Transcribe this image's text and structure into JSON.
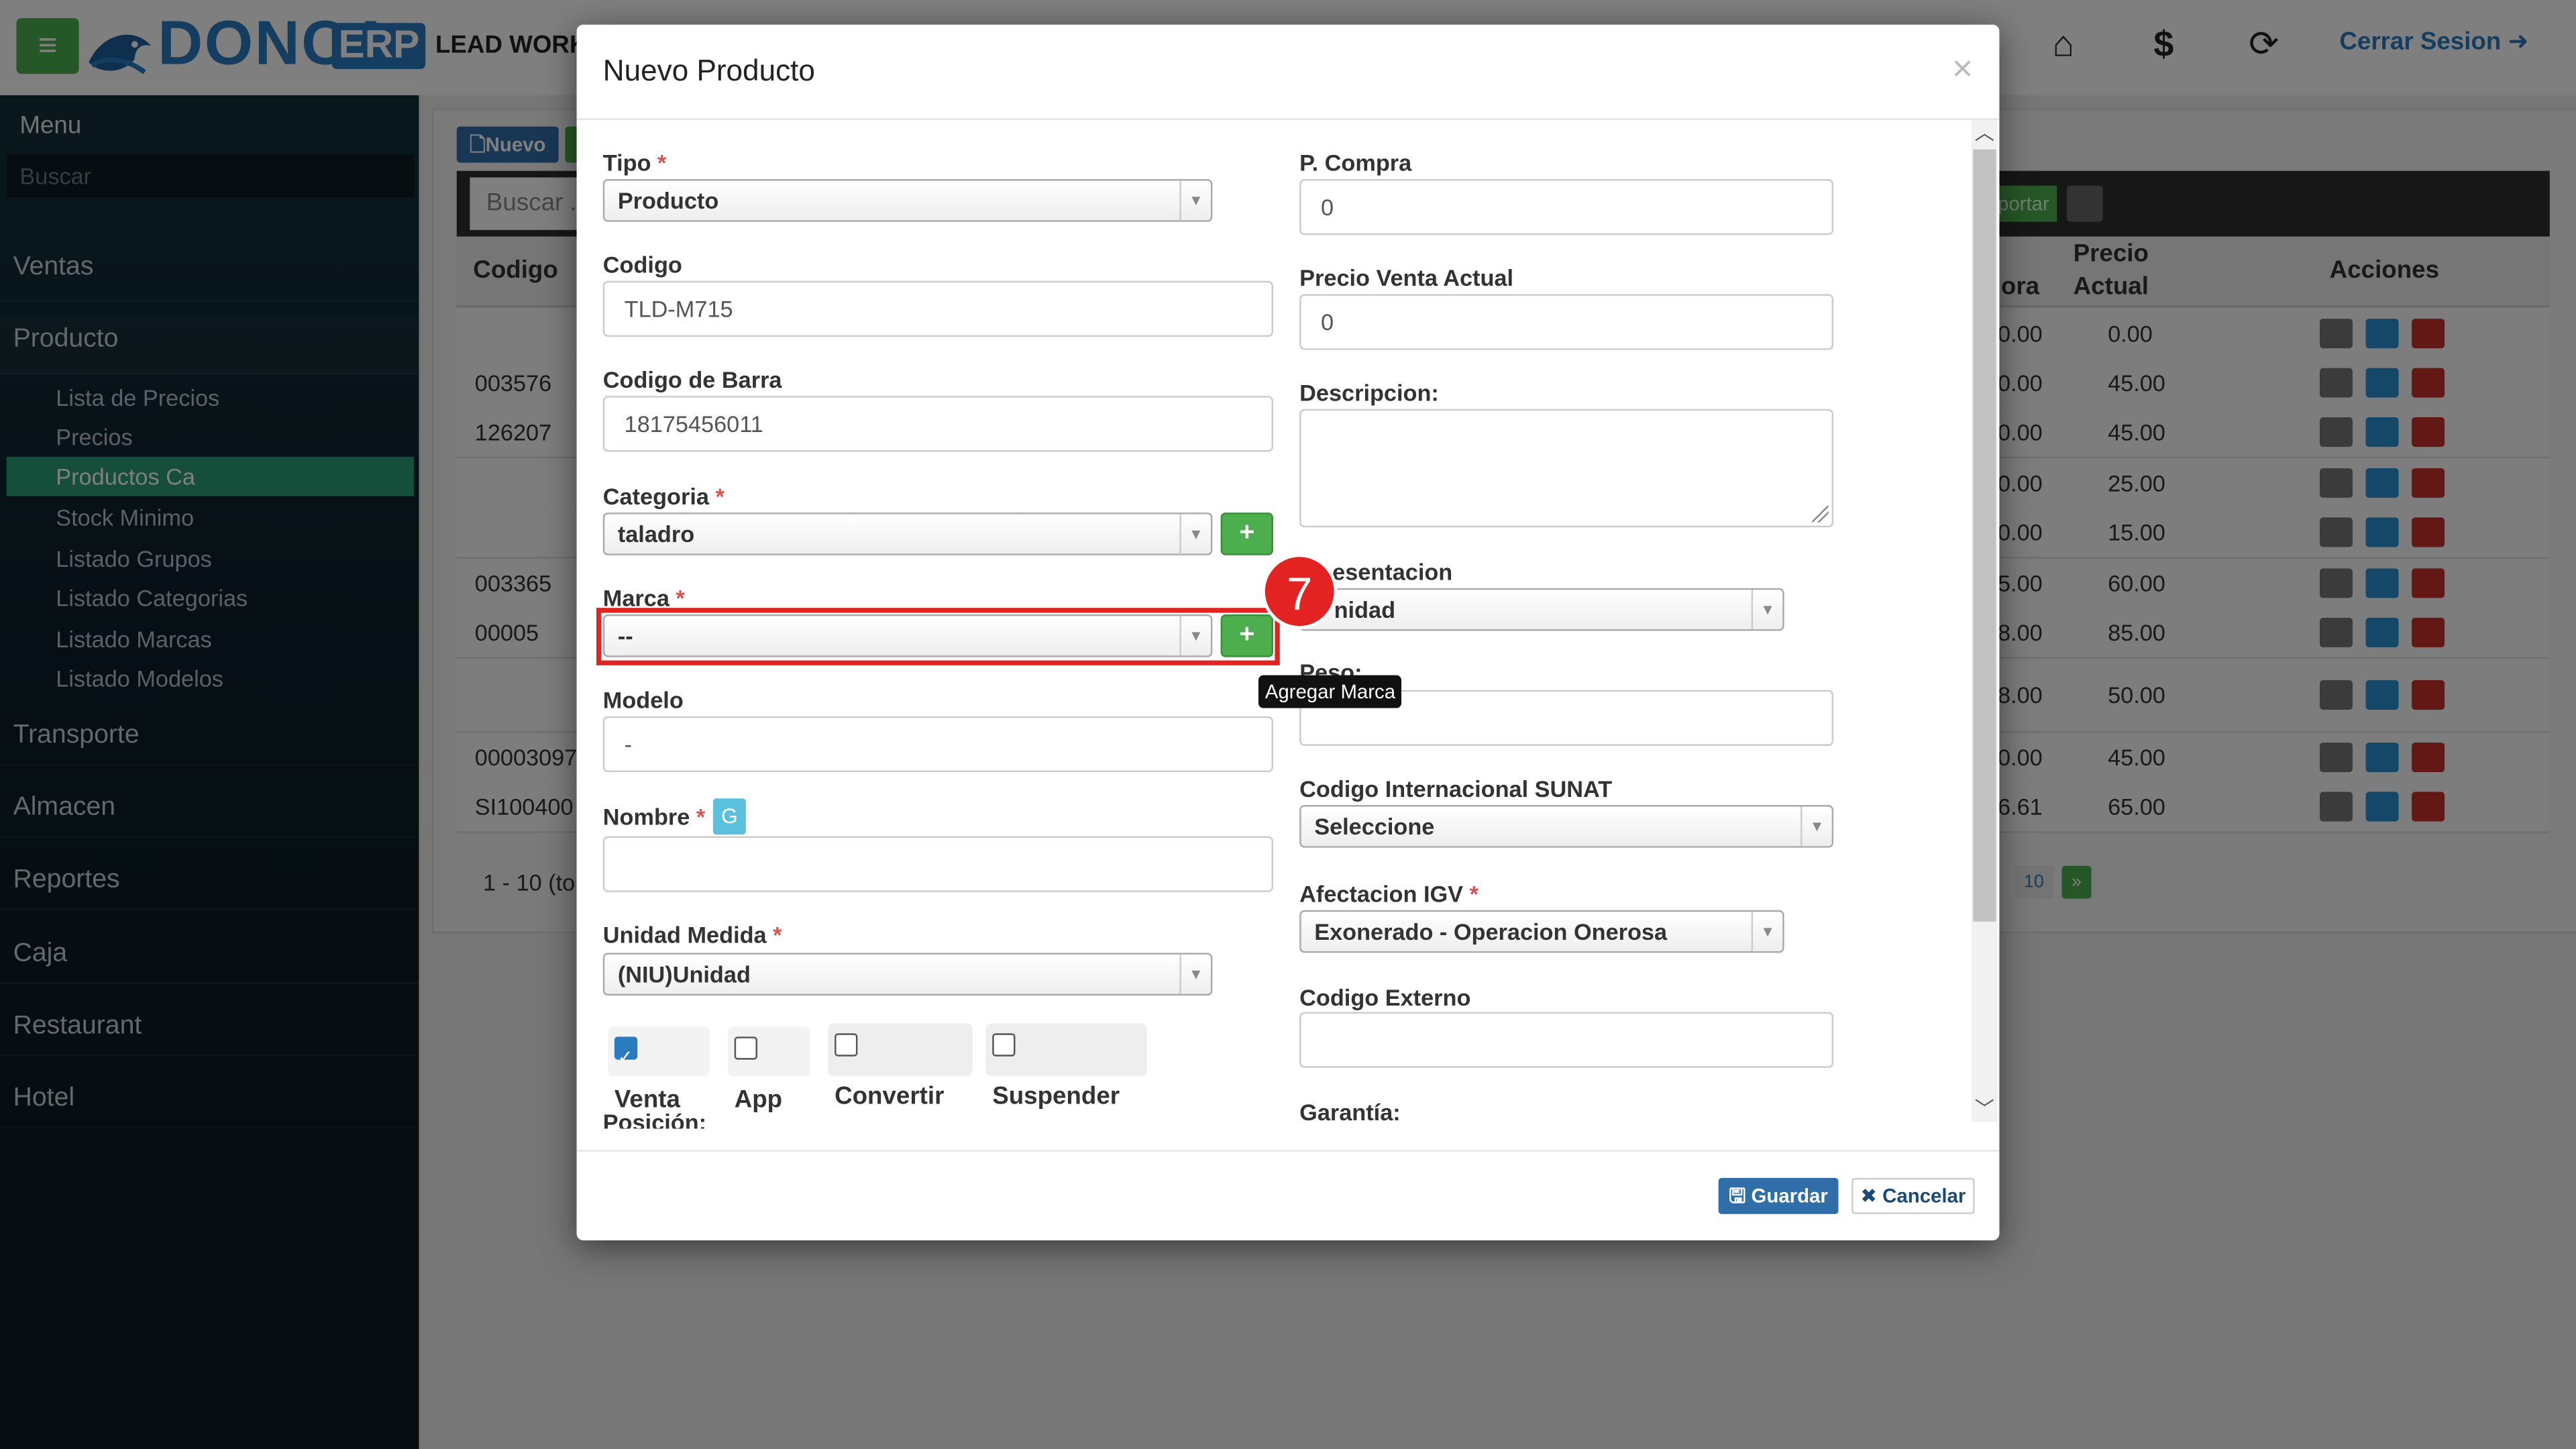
{
  "topbar": {
    "brand": "DONCA",
    "brand_suffix": "ERP",
    "company": "LEAD WORK",
    "icons": [
      "menu-icon",
      "home-icon",
      "dollar-icon",
      "lock-refresh-icon"
    ],
    "logout_label": "Cerrar Sesion"
  },
  "sidebar": {
    "title": "Menu",
    "search_placeholder": "Buscar",
    "items": [
      "Ventas",
      "Producto",
      "Transporte",
      "Almacen",
      "Reportes",
      "Caja",
      "Restaurant",
      "Hotel"
    ],
    "sub_items": [
      "Lista de Precios",
      "Precios",
      "Productos Ca",
      "Stock Minimo",
      "Listado Grupos",
      "Listado Categorias",
      "Listado Marcas",
      "Listado Modelos"
    ],
    "active_sub": "Productos Ca"
  },
  "background": {
    "new_button": "Nuevo",
    "search_placeholder": "Buscar .",
    "export_label": "portar",
    "columns": {
      "codigo": "Codigo",
      "compra_fragment": "ora",
      "precio_actual_line1": "Precio",
      "precio_actual_line2": "Actual",
      "acciones": "Acciones"
    },
    "rows": [
      {
        "codigo": "",
        "compra": "0.00",
        "precio": "0.00"
      },
      {
        "codigo": "003576",
        "compra": "0.00",
        "precio": "45.00"
      },
      {
        "codigo": "126207",
        "compra": "0.00",
        "precio": "45.00"
      },
      {
        "codigo": "",
        "compra": "0.00",
        "precio": "25.00"
      },
      {
        "codigo": "",
        "compra": "0.00",
        "precio": "15.00"
      },
      {
        "codigo": "003365",
        "compra": "5.00",
        "precio": "60.00"
      },
      {
        "codigo": "00005",
        "compra": "8.00",
        "precio": "85.00"
      },
      {
        "codigo": "",
        "compra": "8.00",
        "precio": "50.00"
      },
      {
        "codigo": "00003097",
        "compra": "0.00",
        "precio": "45.00"
      },
      {
        "codigo": "SI100400",
        "compra": "6.61",
        "precio": "65.00"
      }
    ],
    "pager_info": "1 - 10 (to",
    "pager_page": "10",
    "pager_next": "»"
  },
  "modal": {
    "title": "Nuevo Producto",
    "close": "×",
    "left": {
      "tipo_label": "Tipo",
      "tipo_value": "Producto",
      "codigo_label": "Codigo",
      "codigo_value": "TLD-M715",
      "barra_label": "Codigo de Barra",
      "barra_value": "18175456011",
      "categoria_label": "Categoria",
      "categoria_value": "taladro",
      "marca_label": "Marca",
      "marca_value": "--",
      "modelo_label": "Modelo",
      "modelo_value": "-",
      "nombre_label": "Nombre",
      "nombre_badge": "G",
      "nombre_value": "",
      "unidad_label": "Unidad Medida",
      "unidad_value": "(NIU)Unidad",
      "checkboxes": [
        {
          "label": "Venta",
          "checked": true
        },
        {
          "label": "App",
          "checked": false
        },
        {
          "label": "Convertir",
          "checked": false
        },
        {
          "label": "Suspender",
          "checked": false
        }
      ],
      "posicion_label": "Posición:"
    },
    "right": {
      "compra_label": "P. Compra",
      "compra_value": "0",
      "venta_label": "Precio Venta Actual",
      "venta_value": "0",
      "descripcion_label": "Descripcion:",
      "presentacion_label": "esentacion",
      "presentacion_value": "nidad",
      "peso_label": "Peso:",
      "sunat_label": "Codigo Internacional SUNAT",
      "sunat_value": "Seleccione",
      "igv_label": "Afectacion IGV",
      "igv_value": "Exonerado - Operacion Onerosa",
      "externo_label": "Codigo Externo",
      "garantia_label": "Garantía:"
    },
    "add_symbol": "+",
    "required_mark": "*",
    "step_number": "7",
    "tooltip": "Agregar Marca",
    "save_label": "Guardar",
    "cancel_label": "Cancelar"
  },
  "colors": {
    "primary": "#2b7bbf",
    "success": "#4cae4c",
    "danger": "#e32222",
    "sidebar_active": "#2a9d76"
  }
}
